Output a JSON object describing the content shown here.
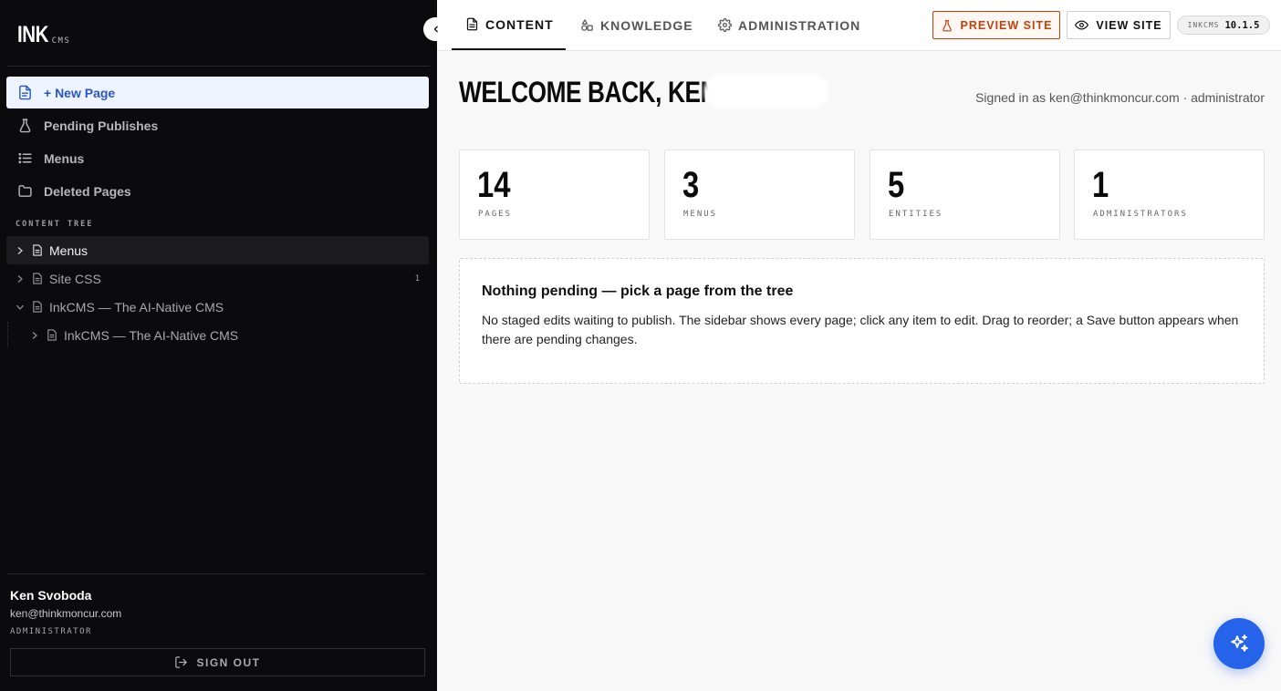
{
  "brand": {
    "name": "INK",
    "suffix": "CMS"
  },
  "sidebar": {
    "nav": [
      {
        "label": "+ New Page",
        "icon": "file-plus-icon",
        "active": true
      },
      {
        "label": "Pending Publishes",
        "icon": "flask-icon"
      },
      {
        "label": "Menus",
        "icon": "list-icon"
      },
      {
        "label": "Deleted Pages",
        "icon": "folder-icon"
      }
    ],
    "tree_heading": "CONTENT TREE",
    "tree": [
      {
        "label": "Menus",
        "expanded": false,
        "active": true
      },
      {
        "label": "Site CSS",
        "expanded": false,
        "count": "1"
      },
      {
        "label": "InkCMS — The AI-Native CMS",
        "expanded": true
      },
      {
        "label": "InkCMS — The AI-Native CMS",
        "expanded": false,
        "child": true
      }
    ],
    "user": {
      "name": "Ken Svoboda",
      "email": "ken@thinkmoncur.com",
      "role": "ADMINISTRATOR"
    },
    "signout_label": "SIGN OUT"
  },
  "topbar": {
    "tabs": [
      {
        "label": "CONTENT",
        "icon": "file-icon",
        "active": true
      },
      {
        "label": "KNOWLEDGE",
        "icon": "shapes-icon"
      },
      {
        "label": "ADMINISTRATION",
        "icon": "gear-icon"
      }
    ],
    "preview_label": "PREVIEW SITE",
    "view_label": "VIEW SITE",
    "version_label": "INKCMS",
    "version_number": "10.1.5"
  },
  "main": {
    "welcome": "WELCOME BACK, KEN",
    "signed_in": "Signed in as ken@thinkmoncur.com · administrator",
    "stats": [
      {
        "value": "14",
        "label": "PAGES"
      },
      {
        "value": "3",
        "label": "MENUS"
      },
      {
        "value": "5",
        "label": "ENTITIES"
      },
      {
        "value": "1",
        "label": "ADMINISTRATORS"
      }
    ],
    "pending": {
      "title": "Nothing pending — pick a page from the tree",
      "body": "No staged edits waiting to publish. The sidebar shows every page; click any item to edit. Drag to reorder; a Save button appears when there are pending changes."
    }
  },
  "colors": {
    "accent": "#2563eb",
    "preview": "#c2410c",
    "sidebar_bg": "#0b0b0d"
  }
}
